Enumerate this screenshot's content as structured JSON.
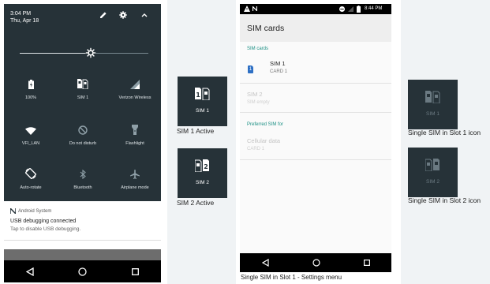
{
  "quick_settings": {
    "time": "3:04 PM",
    "date": "Thu, Apr 18",
    "header_icons": [
      "pencil-icon",
      "gear-icon",
      "chevron-up-icon"
    ],
    "brightness_level": 0.55,
    "tiles": [
      {
        "label": "100%",
        "icon": "battery-icon",
        "dim": false
      },
      {
        "label": "SIM 1",
        "icon": "dual-sim-icon",
        "dim": false
      },
      {
        "label": "Verizon Wireless",
        "icon": "signal-icon",
        "dim": false
      },
      {
        "label": "VFI_LAN",
        "icon": "wifi-icon",
        "dim": false
      },
      {
        "label": "Do not disturb",
        "icon": "do-not-disturb-icon",
        "dim": true
      },
      {
        "label": "Flashlight",
        "icon": "flashlight-icon",
        "dim": true
      },
      {
        "label": "Auto-rotate",
        "icon": "auto-rotate-icon",
        "dim": false
      },
      {
        "label": "Bluetooth",
        "icon": "bluetooth-icon",
        "dim": true
      },
      {
        "label": "Airplane mode",
        "icon": "airplane-icon",
        "dim": true
      }
    ]
  },
  "notification": {
    "app": "Android System",
    "title": "USB debugging connected",
    "text": "Tap to disable USB debugging."
  },
  "sim_tiles": [
    {
      "label": "SIM 1",
      "caption": "SIM 1 Active",
      "active_slot": 1,
      "dim": false
    },
    {
      "label": "SIM 2",
      "caption": "SIM 2 Active",
      "active_slot": 2,
      "dim": false
    },
    {
      "label": "SIM 1",
      "caption": "Single SIM in Slot 1 icon",
      "active_slot": 1,
      "dim": true
    },
    {
      "label": "SIM 2",
      "caption": "Single SIM in Slot 2 icon",
      "active_slot": 2,
      "dim": true
    }
  ],
  "settings": {
    "status_time": "8:44 PM",
    "title": "SIM cards",
    "section_sim_cards": "SIM cards",
    "sim1": {
      "badge": "1",
      "name": "SIM 1",
      "sub": "CARD 1"
    },
    "sim2": {
      "name": "SIM 2",
      "sub": "SIM empty"
    },
    "section_preferred": "Preferred SIM for",
    "cellular": {
      "name": "Cellular data",
      "sub": "CARD 1"
    },
    "caption": "Single SIM in Slot 1 - Settings menu"
  },
  "colors": {
    "panel_dark": "#263238",
    "accent_teal": "#1b8f84",
    "sim_badge_blue": "#2d6fc4"
  }
}
